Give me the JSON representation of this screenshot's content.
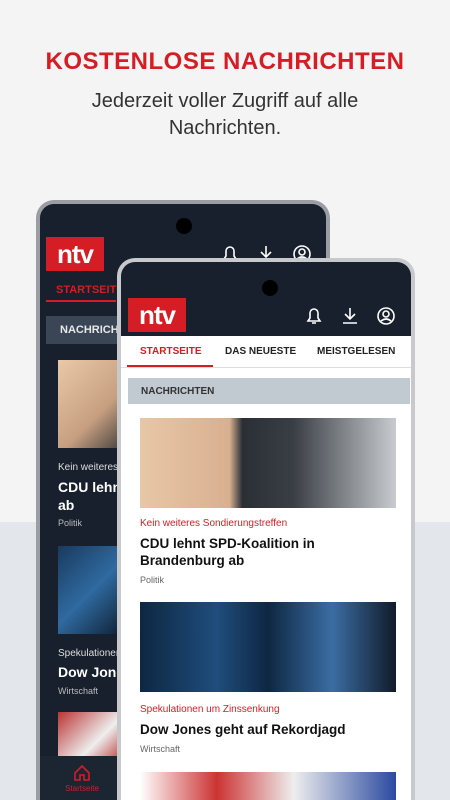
{
  "headline": "KOSTENLOSE NACHRICHTEN",
  "subline": "Jederzeit voller Zugriff auf alle Nachrichten.",
  "logo_text": "ntv",
  "colors": {
    "brand_red": "#d41d24",
    "dark_header": "#17202c"
  },
  "back_phone": {
    "tab": "STARTSEITE",
    "section": "NACHRICHTEN",
    "articles": [
      {
        "kicker": "Kein weiteres",
        "title": "CDU lehnt ab",
        "category": "Politik"
      },
      {
        "kicker": "Spekulationen",
        "title": "Dow Jones",
        "category": "Wirtschaft"
      }
    ],
    "nav_home": "Startseite"
  },
  "front_phone": {
    "tabs": [
      "STARTSEITE",
      "DAS NEUESTE",
      "MEISTGELESEN"
    ],
    "section": "NACHRICHTEN",
    "header_icons": [
      "bell-icon",
      "download-icon",
      "account-icon"
    ],
    "articles": [
      {
        "kicker": "Kein weiteres Sondierungstreffen",
        "title": "CDU lehnt SPD-Koalition in Brandenburg ab",
        "category": "Politik"
      },
      {
        "kicker": "Spekulationen um Zinssenkung",
        "title": "Dow Jones geht auf Rekordjagd",
        "category": "Wirtschaft"
      }
    ]
  }
}
